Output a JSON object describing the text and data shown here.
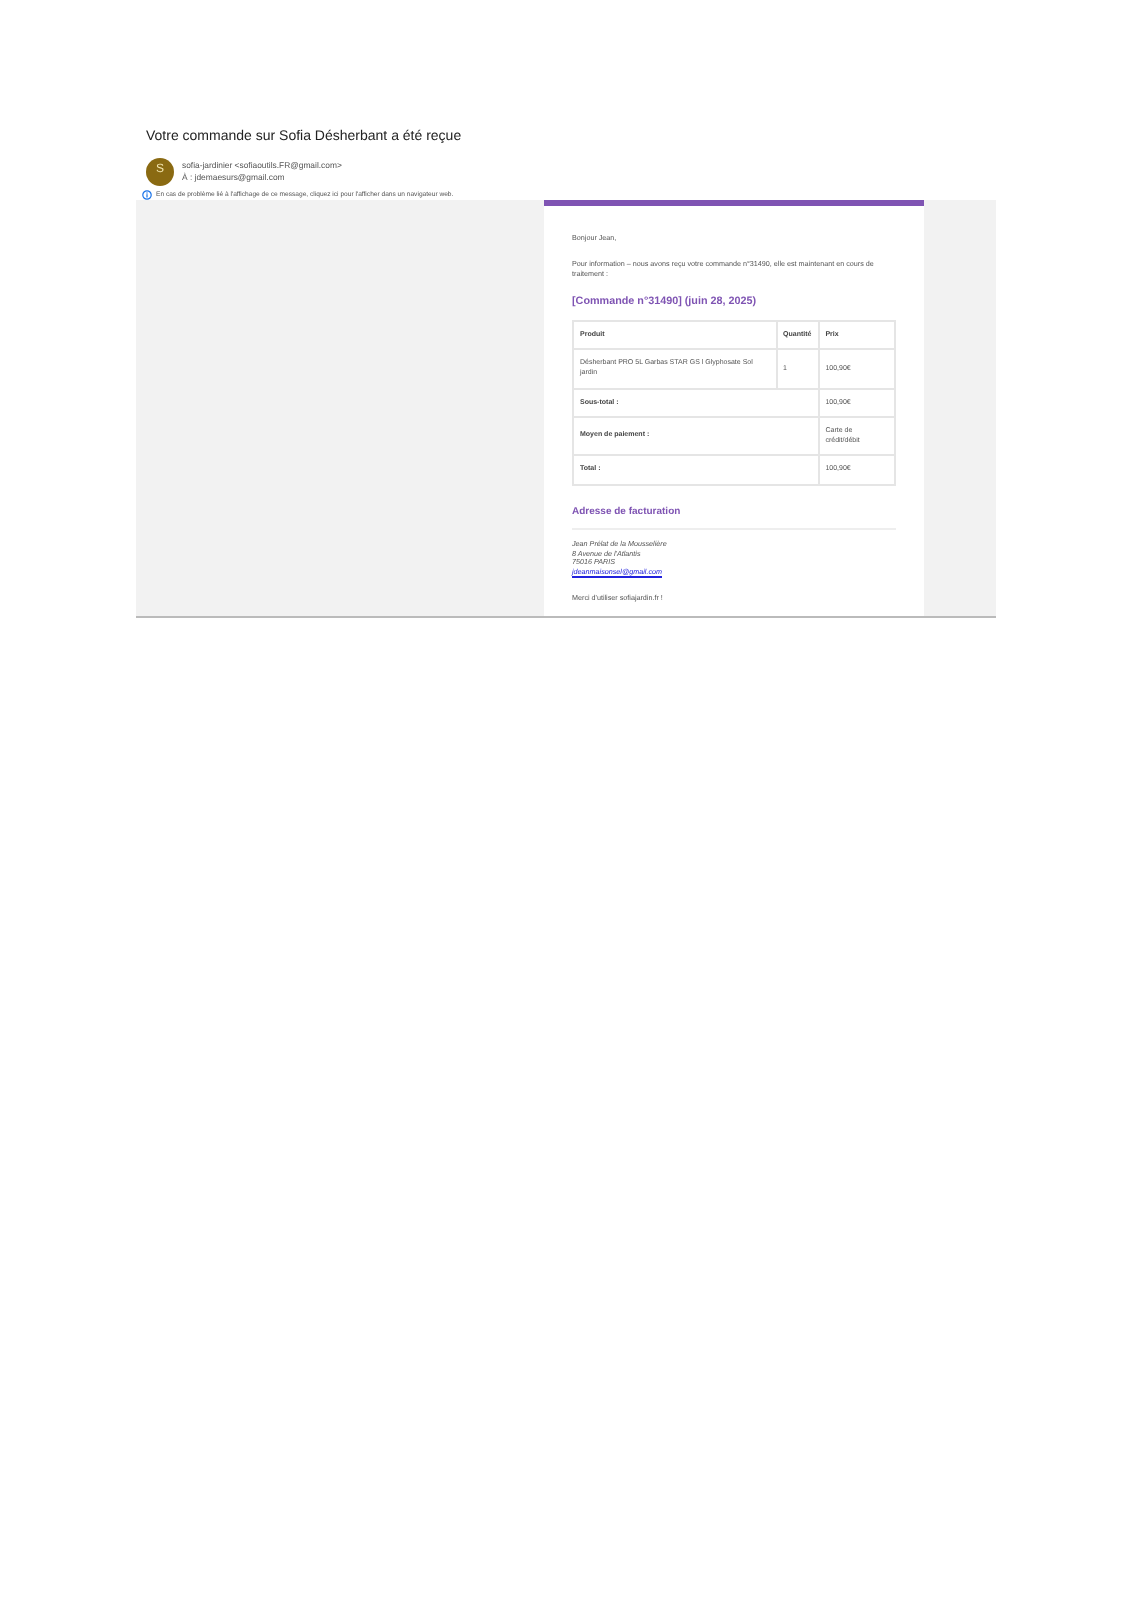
{
  "email": {
    "subject": "Votre commande sur Sofia Désherbant a été reçue",
    "avatar_initial": "S",
    "sender": "sofia-jardinier <sofiaoutils.FR@gmail.com>",
    "recipient": "À : jdemaesurs@gmail.com",
    "notice": "En cas de problème lié à l'affichage de ce message, cliquez ici pour l'afficher dans un navigateur web."
  },
  "message": {
    "greeting": "Bonjour Jean,",
    "intro": "Pour information – nous avons reçu votre commande n°31490, elle est maintenant en cours de traitement :",
    "order_heading": "[Commande n°31490] (juin 28, 2025)",
    "table": {
      "columns": [
        "Produit",
        "Quantité",
        "Prix"
      ],
      "rows": [
        [
          "Désherbant PRO 5L Garbas STAR GS l Glyphosate Sol jardin",
          "1",
          "100,90€"
        ]
      ],
      "totals": [
        {
          "label": "Sous-total :",
          "value": "100,90€"
        },
        {
          "label": "Moyen de paiement :",
          "value": "Carte de crédit/débit"
        },
        {
          "label": "Total :",
          "value": "100,90€"
        }
      ]
    },
    "billing_heading": "Adresse de facturation",
    "address_lines": [
      "Jean Prélat de la Mousselière",
      "8 Avenue de l'Atlantis",
      "75016 PARIS"
    ],
    "address_email": "jdeanmaisonsel@gmail.com",
    "closing": "Merci d'utiliser sofiajardin.fr !"
  }
}
